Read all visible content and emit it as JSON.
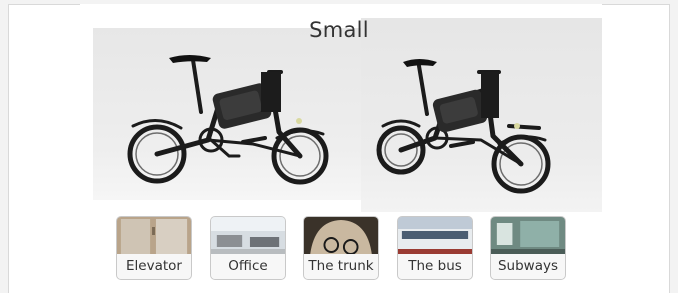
{
  "heading": "Small",
  "scenes": [
    {
      "label": "Elevator",
      "icon": "elevator-scene"
    },
    {
      "label": "Office",
      "icon": "office-scene"
    },
    {
      "label": "The trunk",
      "icon": "car-trunk-scene"
    },
    {
      "label": "The bus",
      "icon": "bus-scene"
    },
    {
      "label": "Subways",
      "icon": "subway-scene"
    }
  ]
}
